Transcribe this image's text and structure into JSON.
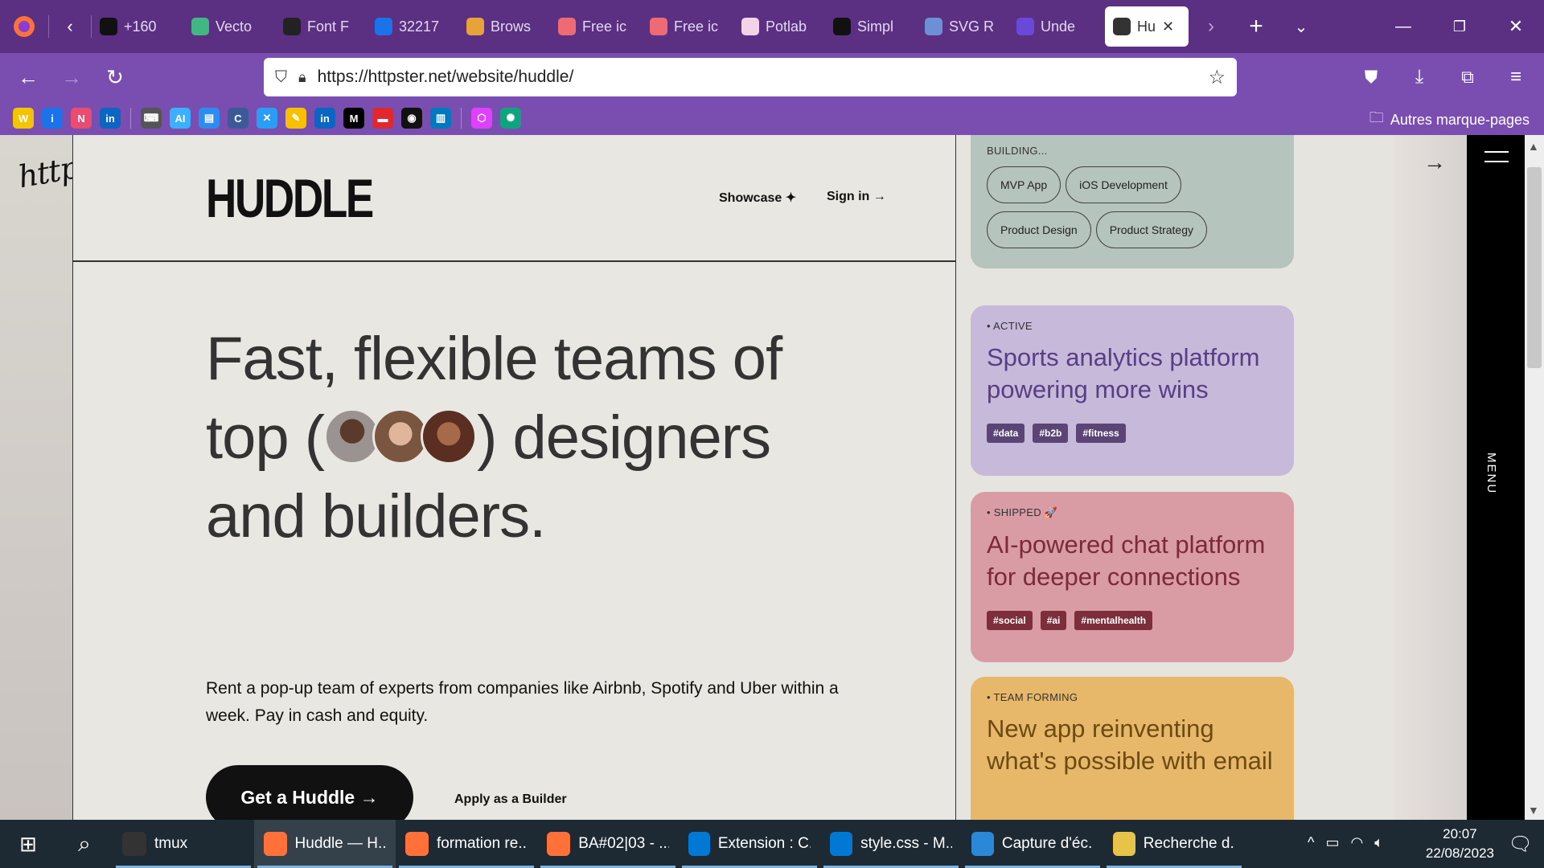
{
  "browser": {
    "tabs": [
      {
        "label": "+160",
        "icon": "slash-icon",
        "color": "#111111"
      },
      {
        "label": "Vecto",
        "icon": "vue-icon",
        "color": "#41b883"
      },
      {
        "label": "Font F",
        "icon": "fontawesome-icon",
        "color": "#222222"
      },
      {
        "label": "32217",
        "icon": "info-icon",
        "color": "#1a73e8"
      },
      {
        "label": "Brows",
        "icon": "brows-icon",
        "color": "#e8a23a"
      },
      {
        "label": "Free ic",
        "icon": "tag-icon",
        "color": "#ef6b73"
      },
      {
        "label": "Free ic",
        "icon": "tag-icon",
        "color": "#ef6b73"
      },
      {
        "label": "Potlab",
        "icon": "potlab-icon",
        "color": "#f3d4e6"
      },
      {
        "label": "Simpl",
        "icon": "simple-icon",
        "color": "#111111"
      },
      {
        "label": "SVG R",
        "icon": "repo-icon",
        "color": "#6c8fd6"
      },
      {
        "label": "Unde",
        "icon": "d-icon",
        "color": "#6a49d8"
      },
      {
        "label": "Hu",
        "icon": "bolt-icon",
        "color": "#333333"
      }
    ],
    "url": "https://httpster.net/website/huddle/",
    "bookmarks_other": "Autres marque-pages",
    "bookmarks": [
      {
        "icon": "w-icon",
        "color": "#f5c400",
        "text": "W"
      },
      {
        "icon": "info-icon",
        "color": "#1a73e8",
        "text": "i"
      },
      {
        "icon": "n8n-icon",
        "color": "#ea4b71",
        "text": "N"
      },
      {
        "icon": "linkedin-icon",
        "color": "#0a66c2",
        "text": "in"
      },
      {
        "icon": "keyboard-icon",
        "color": "#555555",
        "text": "⌨"
      },
      {
        "icon": "ai-icon",
        "color": "#3ab0ff",
        "text": "AI"
      },
      {
        "icon": "form-icon",
        "color": "#2d8cf0",
        "text": "▤"
      },
      {
        "icon": "c-icon",
        "color": "#3c5a9a",
        "text": "C"
      },
      {
        "icon": "x-icon",
        "color": "#2a9df4",
        "text": "✕"
      },
      {
        "icon": "pencil-icon",
        "color": "#f7c000",
        "text": "✎"
      },
      {
        "icon": "linkedin-icon",
        "color": "#0a66c2",
        "text": "in"
      },
      {
        "icon": "m-icon",
        "color": "#000000",
        "text": "M"
      },
      {
        "icon": "bus-icon",
        "color": "#e0282e",
        "text": "▬"
      },
      {
        "icon": "github-icon",
        "color": "#111111",
        "text": "◉"
      },
      {
        "icon": "trello-icon",
        "color": "#0079bf",
        "text": "▥"
      },
      {
        "icon": "hex-icon",
        "color": "#e040fb",
        "text": "⬡"
      },
      {
        "icon": "chatgpt-icon",
        "color": "#10a37f",
        "text": "✺"
      }
    ]
  },
  "site": {
    "logo": "httpster",
    "brand": "HUDDLE",
    "nav": {
      "showcase": "Showcase ✦",
      "signin": "Sign in →"
    },
    "hero_line1": "Fast, flexible teams of",
    "hero_line2a": "top (",
    "hero_line2b": ") designers",
    "hero_line3": "and builders.",
    "subtext": "Rent a pop-up team of experts from companies like Airbnb, Spotify and Uber within a week. Pay in cash and equity.",
    "cta": "Get a Huddle →",
    "apply": "Apply as a Builder"
  },
  "panel": {
    "building": {
      "status": "BUILDING...",
      "pills": [
        "MVP App",
        "iOS Development",
        "Product Design",
        "Product Strategy"
      ],
      "color": "#b6c4be"
    },
    "cards": [
      {
        "status": "• ACTIVE",
        "title": "Sports analytics platform powering more wins",
        "tags": [
          "#data",
          "#b2b",
          "#fitness"
        ],
        "color": "#c6b9da",
        "text": "#5a3e85",
        "tag": "#5b4577"
      },
      {
        "status": "• SHIPPED 🚀",
        "title": "AI-powered chat platform for deeper connections",
        "tags": [
          "#social",
          "#ai",
          "#mentalhealth"
        ],
        "color": "#d99ca4",
        "text": "#7a2a3a",
        "tag": "#7d2e3b"
      },
      {
        "status": "• TEAM FORMING",
        "title": "New app reinventing what's possible with email",
        "tags": [],
        "color": "#e8b86a",
        "text": "#6d4a12",
        "tag": "#6d4a12"
      }
    ],
    "menu": "MENU"
  },
  "taskbar": {
    "items": [
      {
        "label": "tmux",
        "icon": "terminal-icon",
        "color": "#333333"
      },
      {
        "label": "Huddle — H...",
        "icon": "firefox-icon",
        "color": "#ff7139"
      },
      {
        "label": "formation re...",
        "icon": "firefox-icon",
        "color": "#ff7139"
      },
      {
        "label": "BA#02|03 - ...",
        "icon": "firefox-icon",
        "color": "#ff7139"
      },
      {
        "label": "Extension : C...",
        "icon": "vscode-icon",
        "color": "#0078d4"
      },
      {
        "label": "style.css - M...",
        "icon": "vscode-icon",
        "color": "#0078d4"
      },
      {
        "label": "Capture d'éc...",
        "icon": "image-icon",
        "color": "#2b88d8"
      },
      {
        "label": "Recherche d...",
        "icon": "folder-icon",
        "color": "#e8c34a"
      }
    ],
    "time": "20:07",
    "date": "22/08/2023"
  }
}
